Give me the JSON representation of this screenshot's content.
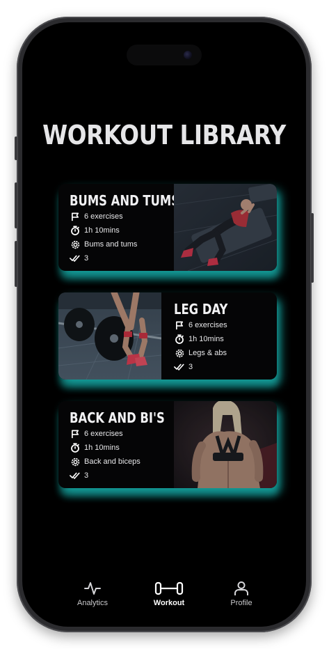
{
  "page": {
    "title": "WORKOUT LIBRARY"
  },
  "workouts": [
    {
      "title": "BUMS AND TUMS",
      "exercises": "6 exercises",
      "duration": "1h 10mins",
      "focus": "Bums and tums",
      "completed": "3",
      "image": "woman-doing-situps-on-mat"
    },
    {
      "title": "LEG DAY",
      "exercises": "6 exercises",
      "duration": "1h 10mins",
      "focus": "Legs & abs",
      "completed": "3",
      "image": "athlete-lifting-barbell"
    },
    {
      "title": "BACK AND BI'S",
      "exercises": "6 exercises",
      "duration": "1h 10mins",
      "focus": "Back and biceps",
      "completed": "3",
      "image": "woman-back-muscles"
    }
  ],
  "tabbar": {
    "items": [
      {
        "label": "Analytics",
        "icon": "activity-pulse-icon"
      },
      {
        "label": "Workout",
        "icon": "dumbbell-icon",
        "active": true
      },
      {
        "label": "Profile",
        "icon": "user-icon"
      }
    ]
  },
  "colors": {
    "background": "#000000",
    "accent_glow": "#1ee1dc",
    "text": "#e6e6e8"
  }
}
